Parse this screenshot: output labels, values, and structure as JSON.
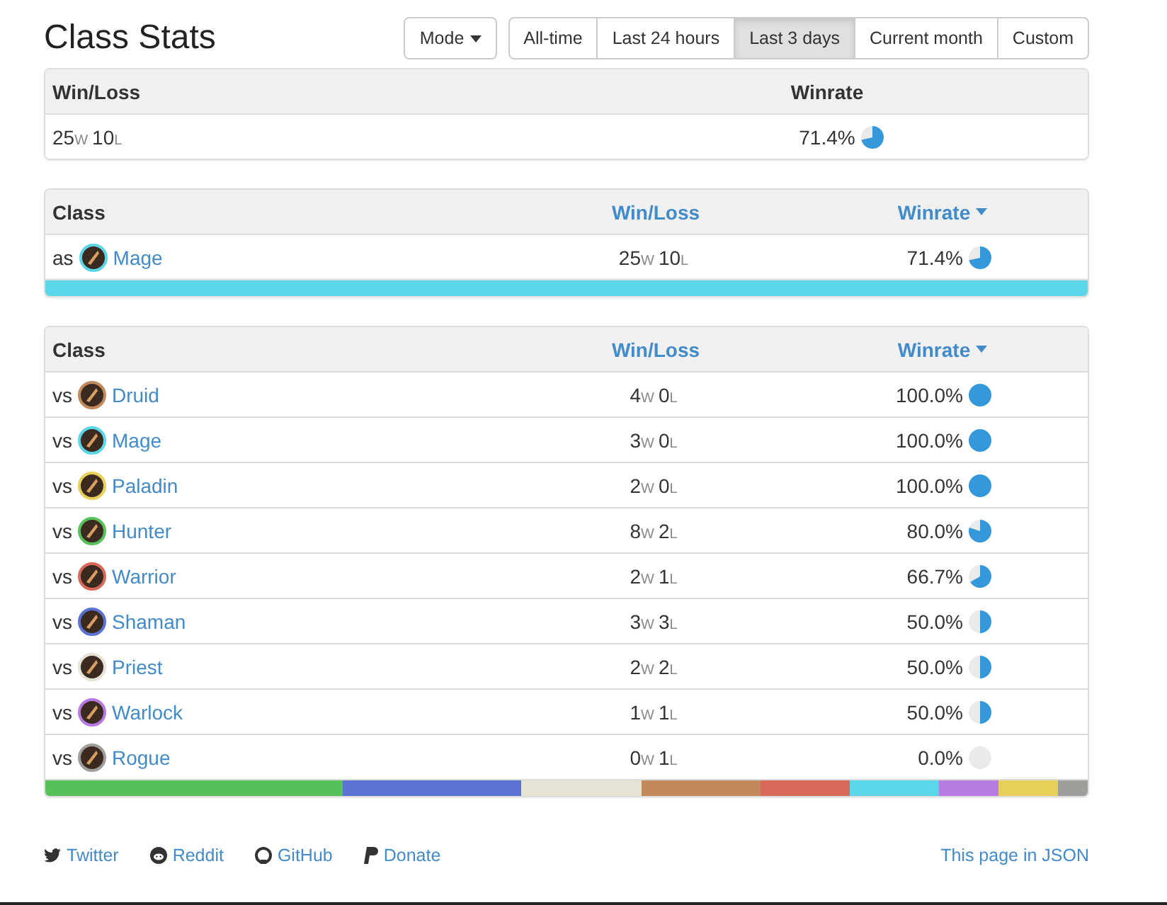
{
  "title": "Class Stats",
  "mode_button": {
    "label": "Mode"
  },
  "periods": [
    {
      "label": "All-time",
      "selected": false
    },
    {
      "label": "Last 24 hours",
      "selected": false
    },
    {
      "label": "Last 3 days",
      "selected": true
    },
    {
      "label": "Current month",
      "selected": false
    },
    {
      "label": "Custom",
      "selected": false
    }
  ],
  "summary": {
    "columns": [
      {
        "label": "Win/Loss"
      },
      {
        "label": "Winrate"
      }
    ],
    "row": {
      "wins": "25",
      "win_mark": "W",
      "losses": "10",
      "loss_mark": "L",
      "winrate": "71.4%"
    }
  },
  "as_table": {
    "columns": [
      {
        "label": "Class",
        "link": false,
        "sorted": false
      },
      {
        "label": "Win/Loss",
        "link": true,
        "sorted": false
      },
      {
        "label": "Winrate",
        "link": true,
        "sorted": true
      }
    ],
    "rows": [
      {
        "prefix": "as",
        "class": "Mage",
        "color": "#5bd6e8",
        "wins": "25",
        "win_mark": "W",
        "losses": "10",
        "loss_mark": "L",
        "winrate": "71.4%"
      }
    ]
  },
  "vs_table": {
    "columns": [
      {
        "label": "Class",
        "link": false,
        "sorted": false
      },
      {
        "label": "Win/Loss",
        "link": true,
        "sorted": false
      },
      {
        "label": "Winrate",
        "link": true,
        "sorted": true
      }
    ],
    "rows": [
      {
        "prefix": "vs",
        "class": "Druid",
        "color": "#c28a5c",
        "wins": "4",
        "win_mark": "W",
        "losses": "0",
        "loss_mark": "L",
        "winrate": "100.0%"
      },
      {
        "prefix": "vs",
        "class": "Mage",
        "color": "#5bd6e8",
        "wins": "3",
        "win_mark": "W",
        "losses": "0",
        "loss_mark": "L",
        "winrate": "100.0%"
      },
      {
        "prefix": "vs",
        "class": "Paladin",
        "color": "#e8cf5a",
        "wins": "2",
        "win_mark": "W",
        "losses": "0",
        "loss_mark": "L",
        "winrate": "100.0%"
      },
      {
        "prefix": "vs",
        "class": "Hunter",
        "color": "#56c15a",
        "wins": "8",
        "win_mark": "W",
        "losses": "2",
        "loss_mark": "L",
        "winrate": "80.0%"
      },
      {
        "prefix": "vs",
        "class": "Warrior",
        "color": "#d8685a",
        "wins": "2",
        "win_mark": "W",
        "losses": "1",
        "loss_mark": "L",
        "winrate": "66.7%"
      },
      {
        "prefix": "vs",
        "class": "Shaman",
        "color": "#5a72d4",
        "wins": "3",
        "win_mark": "W",
        "losses": "3",
        "loss_mark": "L",
        "winrate": "50.0%"
      },
      {
        "prefix": "vs",
        "class": "Priest",
        "color": "#e6e2d4",
        "wins": "2",
        "win_mark": "W",
        "losses": "2",
        "loss_mark": "L",
        "winrate": "50.0%"
      },
      {
        "prefix": "vs",
        "class": "Warlock",
        "color": "#b67ae0",
        "wins": "1",
        "win_mark": "W",
        "losses": "1",
        "loss_mark": "L",
        "winrate": "50.0%"
      },
      {
        "prefix": "vs",
        "class": "Rogue",
        "color": "#9e9e9a",
        "wins": "0",
        "win_mark": "W",
        "losses": "1",
        "loss_mark": "L",
        "winrate": "0.0%"
      }
    ]
  },
  "footer": {
    "links": [
      {
        "kind": "twitter",
        "label": "Twitter"
      },
      {
        "kind": "reddit",
        "label": "Reddit"
      },
      {
        "kind": "github",
        "label": "GitHub"
      },
      {
        "kind": "paypal",
        "label": "Donate"
      }
    ],
    "json_link": "This page in JSON"
  }
}
